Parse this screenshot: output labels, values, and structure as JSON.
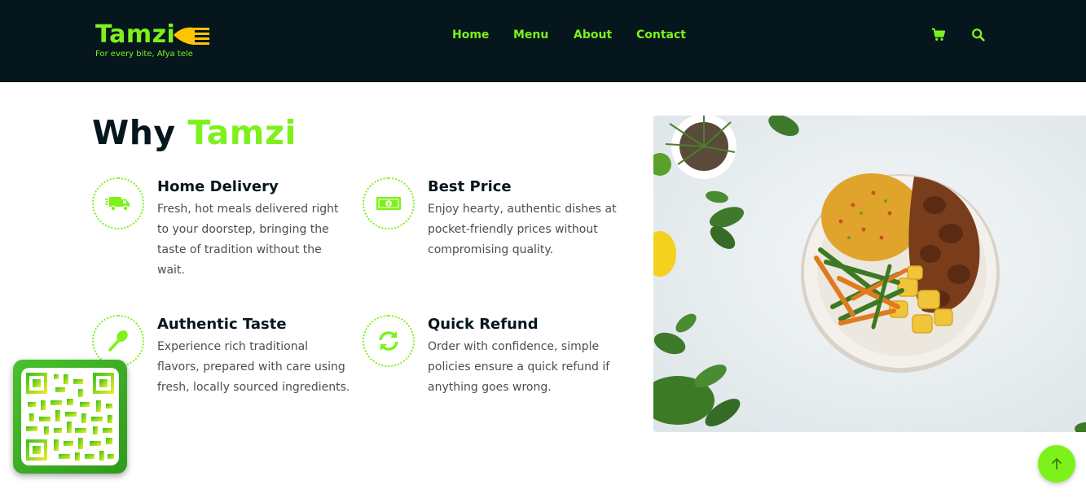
{
  "brand": {
    "name": "Tamzi",
    "tagline": "For every bite, Afya tele",
    "accent_color": "#7cf21a",
    "header_bg": "#06161d"
  },
  "nav": {
    "items": [
      {
        "label": "Home"
      },
      {
        "label": "Menu"
      },
      {
        "label": "About"
      },
      {
        "label": "Contact"
      }
    ],
    "icons": [
      "cart-icon",
      "search-icon"
    ]
  },
  "section": {
    "title_prefix": "Why",
    "title_accent": "Tamzi",
    "features": [
      {
        "icon": "delivery-truck-icon",
        "title": "Home Delivery",
        "description": "Fresh, hot meals delivered right to your doorstep, bringing the taste of tradition without the wait."
      },
      {
        "icon": "money-bill-icon",
        "title": "Best Price",
        "description": "Enjoy hearty, authentic dishes at pocket-friendly prices without compromising quality."
      },
      {
        "icon": "spoon-icon",
        "title": "Authentic Taste",
        "description": "Experience rich traditional flavors, prepared with care using fresh, locally sourced ingredients."
      },
      {
        "icon": "refresh-icon",
        "title": "Quick Refund",
        "description": "Order with confidence, simple policies ensure a quick refund if anything goes wrong."
      }
    ]
  },
  "floating": {
    "qr_icon": "qr-code-icon",
    "back_to_top_icon": "arrow-up-icon"
  }
}
